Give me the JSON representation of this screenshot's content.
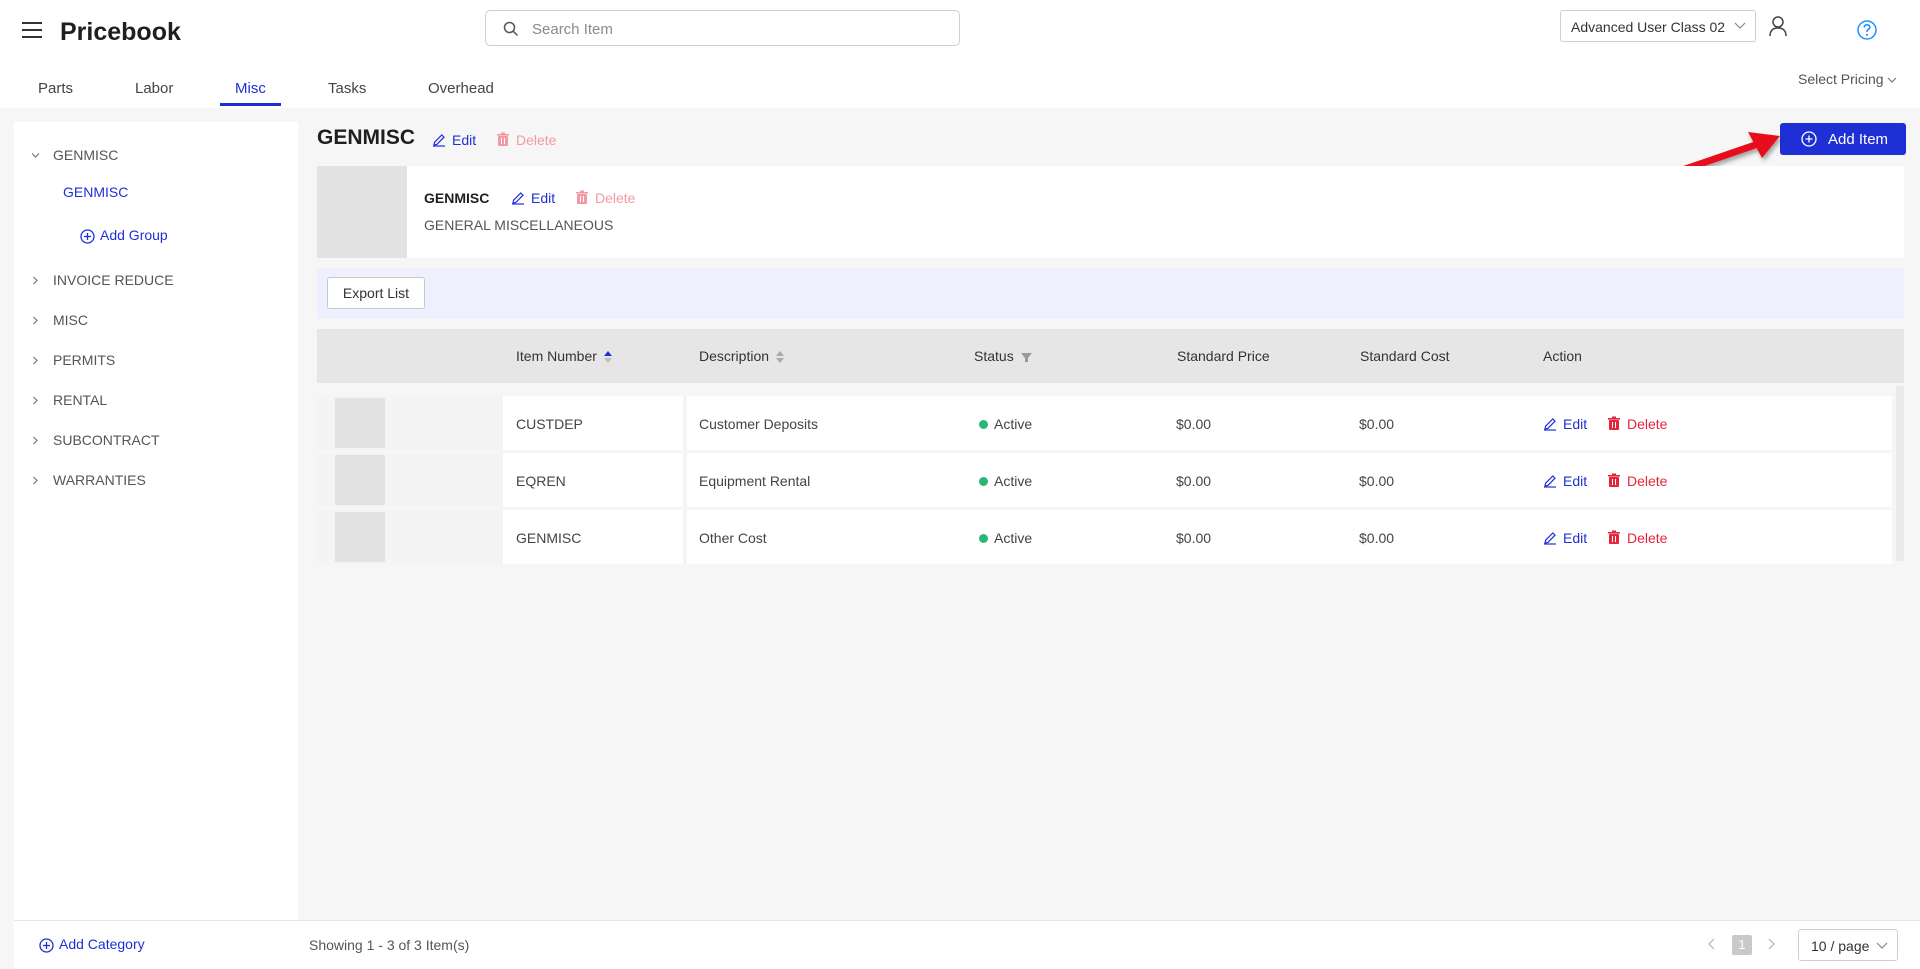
{
  "header": {
    "app_title": "Pricebook",
    "search_placeholder": "Search Item",
    "user_class": "Advanced User Class 02"
  },
  "tabs": [
    {
      "label": "Parts"
    },
    {
      "label": "Labor"
    },
    {
      "label": "Misc",
      "active": true
    },
    {
      "label": "Tasks"
    },
    {
      "label": "Overhead"
    }
  ],
  "select_pricing_label": "Select Pricing",
  "sidebar": {
    "categories": [
      {
        "label": "GENMISC",
        "expanded": true
      },
      {
        "label": "INVOICE REDUCE"
      },
      {
        "label": "MISC"
      },
      {
        "label": "PERMITS"
      },
      {
        "label": "RENTAL"
      },
      {
        "label": "SUBCONTRACT"
      },
      {
        "label": "WARRANTIES"
      }
    ],
    "selected_group": "GENMISC",
    "add_group_label": "Add Group",
    "add_category_label": "Add Category"
  },
  "main": {
    "title": "GENMISC",
    "edit_label": "Edit",
    "delete_label": "Delete",
    "add_item_label": "Add Item",
    "group": {
      "name": "GENMISC",
      "description": "GENERAL MISCELLANEOUS"
    },
    "export_label": "Export List"
  },
  "table": {
    "columns": [
      "Item Number",
      "Description",
      "Status",
      "Standard Price",
      "Standard Cost",
      "Action"
    ],
    "rows": [
      {
        "item_number": "CUSTDEP",
        "description": "Customer Deposits",
        "status": "Active",
        "price": "$0.00",
        "cost": "$0.00"
      },
      {
        "item_number": "EQREN",
        "description": "Equipment Rental",
        "status": "Active",
        "price": "$0.00",
        "cost": "$0.00"
      },
      {
        "item_number": "GENMISC",
        "description": "Other Cost",
        "status": "Active",
        "price": "$0.00",
        "cost": "$0.00"
      }
    ],
    "edit_label": "Edit",
    "delete_label": "Delete"
  },
  "footer": {
    "showing": "Showing 1 - 3 of 3 Item(s)",
    "current_page": "1",
    "per_page": "10 / page"
  },
  "colors": {
    "accent": "#1f2fd6",
    "danger": "#e4263c",
    "active_status": "#2bb673",
    "annotation_arrow": "#e8101c"
  }
}
